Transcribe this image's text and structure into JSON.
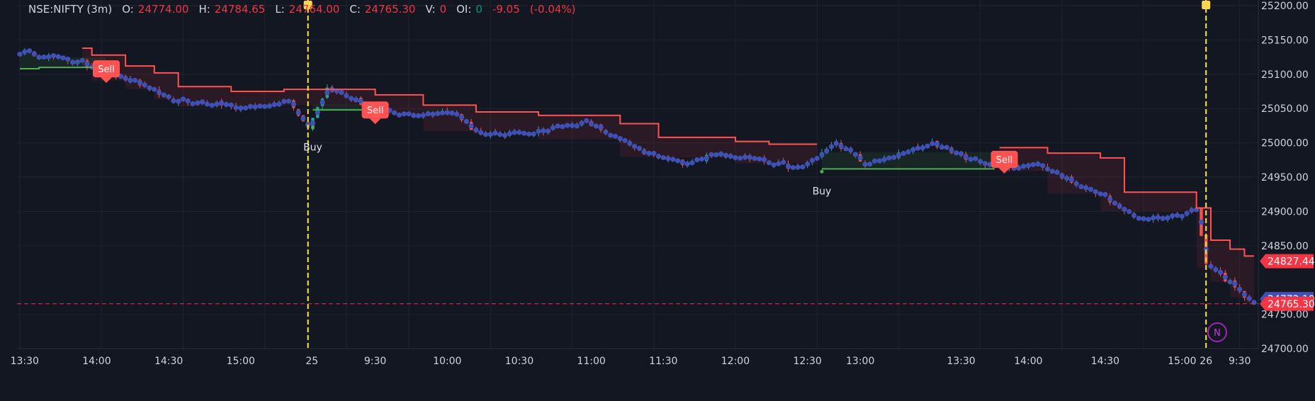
{
  "legend": {
    "symbol": "NSE:NIFTY (3m)",
    "o_label": "O:",
    "o_value": "24774.00",
    "h_label": "H:",
    "h_value": "24784.65",
    "l_label": "L:",
    "l_value": "24764.00",
    "c_label": "C:",
    "c_value": "24765.30",
    "v_label": "V:",
    "v_value": "0",
    "oi_label": "OI:",
    "oi_value": "0",
    "change": "-9.05",
    "change_pct": "(-0.04%)"
  },
  "colors": {
    "background": "#131722",
    "grid": "#1f2430",
    "candle_up": "#26a69a",
    "candle_down": "#ef5350",
    "dot": "#3f51b5",
    "resistance": "#ff5252",
    "support": "#4caf50",
    "session_marker": "#ffeb3b",
    "last_price": "#f23645",
    "ma_label": "#3f51b5"
  },
  "chart_data": {
    "type": "candlestick",
    "ylim": [
      24700,
      25200
    ],
    "y_ticks": [
      "25200.00",
      "25150.00",
      "25100.00",
      "25050.00",
      "25000.00",
      "24950.00",
      "24900.00",
      "24850.00",
      "24750.00",
      "24700.00"
    ],
    "y_tick_values": [
      25200,
      25150,
      25100,
      25050,
      25000,
      24950,
      24900,
      24850,
      24750,
      24700
    ],
    "x_ticks": [
      "13:30",
      "14:00",
      "14:30",
      "15:00",
      "25",
      "9:30",
      "10:00",
      "10:30",
      "11:00",
      "11:30",
      "12:00",
      "12:30",
      "13:00",
      "13:30",
      "14:00",
      "14:30",
      "15:00",
      "26",
      "9:30"
    ],
    "price_labels": [
      {
        "value": 24827.44,
        "text": "24827.44",
        "kind": "resistance"
      },
      {
        "value": 24772.19,
        "text": "24772.19",
        "kind": "ma"
      },
      {
        "value": 24765.3,
        "text": "24765.30",
        "kind": "last"
      }
    ],
    "signals": [
      {
        "type": "sell",
        "label": "Sell"
      },
      {
        "type": "buy",
        "label": "Buy"
      },
      {
        "type": "sell",
        "label": "Sell"
      },
      {
        "type": "buy",
        "label": "Buy"
      },
      {
        "type": "sell",
        "label": "Sell"
      }
    ],
    "session_breaks": [
      "25",
      "26"
    ],
    "watermark": "N",
    "path_segments": [
      {
        "from": 0,
        "to": 12,
        "v0": 25133,
        "v1": 25118
      },
      {
        "from": 12,
        "to": 27,
        "v0": 25118,
        "v1": 25080
      },
      {
        "from": 27,
        "to": 31,
        "v0": 25080,
        "v1": 25062
      },
      {
        "from": 31,
        "to": 43,
        "v0": 25062,
        "v1": 25055
      },
      {
        "from": 43,
        "to": 45,
        "v0": 25055,
        "v1": 25050
      },
      {
        "from": 45,
        "to": 56,
        "v0": 25050,
        "v1": 25060
      },
      {
        "from": 56,
        "to": 60,
        "v0": 25060,
        "v1": 25025
      },
      {
        "from": 60,
        "to": 64,
        "v0": 25025,
        "v1": 25080
      },
      {
        "from": 64,
        "to": 72,
        "v0": 25080,
        "v1": 25055
      },
      {
        "from": 72,
        "to": 80,
        "v0": 25055,
        "v1": 25040
      },
      {
        "from": 80,
        "to": 90,
        "v0": 25040,
        "v1": 25045
      },
      {
        "from": 90,
        "to": 96,
        "v0": 25045,
        "v1": 25010
      },
      {
        "from": 96,
        "to": 106,
        "v0": 25010,
        "v1": 25015
      },
      {
        "from": 106,
        "to": 118,
        "v0": 25015,
        "v1": 25030
      },
      {
        "from": 118,
        "to": 130,
        "v0": 25030,
        "v1": 24985
      },
      {
        "from": 130,
        "to": 138,
        "v0": 24985,
        "v1": 24970
      },
      {
        "from": 138,
        "to": 146,
        "v0": 24970,
        "v1": 24985
      },
      {
        "from": 146,
        "to": 154,
        "v0": 24985,
        "v1": 24975
      },
      {
        "from": 154,
        "to": 162,
        "v0": 24975,
        "v1": 24962
      },
      {
        "from": 162,
        "to": 170,
        "v0": 24962,
        "v1": 25000
      },
      {
        "from": 170,
        "to": 176,
        "v0": 25000,
        "v1": 24968
      },
      {
        "from": 176,
        "to": 184,
        "v0": 24968,
        "v1": 24985
      },
      {
        "from": 184,
        "to": 190,
        "v0": 24985,
        "v1": 25000
      },
      {
        "from": 190,
        "to": 198,
        "v0": 25000,
        "v1": 24975
      },
      {
        "from": 198,
        "to": 206,
        "v0": 24975,
        "v1": 24965
      },
      {
        "from": 206,
        "to": 212,
        "v0": 24965,
        "v1": 24968
      },
      {
        "from": 212,
        "to": 226,
        "v0": 24968,
        "v1": 24920
      },
      {
        "from": 226,
        "to": 232,
        "v0": 24920,
        "v1": 24890
      },
      {
        "from": 232,
        "to": 242,
        "v0": 24890,
        "v1": 24895
      },
      {
        "from": 242,
        "to": 245,
        "v0": 24895,
        "v1": 24905
      },
      {
        "from": 245,
        "to": 247,
        "v0": 24905,
        "v1": 24825
      },
      {
        "from": 247,
        "to": 252,
        "v0": 24825,
        "v1": 24795
      },
      {
        "from": 252,
        "to": 257,
        "v0": 24795,
        "v1": 24765
      }
    ],
    "resistance_steps": [
      {
        "from": 13,
        "to": 15,
        "v": 25138
      },
      {
        "from": 15,
        "to": 22,
        "v": 25128
      },
      {
        "from": 22,
        "to": 28,
        "v": 25112
      },
      {
        "from": 28,
        "to": 33,
        "v": 25102
      },
      {
        "from": 33,
        "to": 44,
        "v": 25082
      },
      {
        "from": 44,
        "to": 55,
        "v": 25075
      },
      {
        "from": 55,
        "to": 74,
        "v": 25078
      },
      {
        "from": 74,
        "to": 84,
        "v": 25070
      },
      {
        "from": 84,
        "to": 95,
        "v": 25055
      },
      {
        "from": 95,
        "to": 108,
        "v": 25045
      },
      {
        "from": 108,
        "to": 125,
        "v": 25040
      },
      {
        "from": 125,
        "to": 133,
        "v": 25028
      },
      {
        "from": 133,
        "to": 149,
        "v": 25008
      },
      {
        "from": 149,
        "to": 156,
        "v": 25002
      },
      {
        "from": 156,
        "to": 166,
        "v": 24998
      },
      {
        "from": 204,
        "to": 214,
        "v": 24993
      },
      {
        "from": 214,
        "to": 225,
        "v": 24985
      },
      {
        "from": 225,
        "to": 230,
        "v": 24978
      },
      {
        "from": 230,
        "to": 245,
        "v": 24928
      },
      {
        "from": 245,
        "to": 248,
        "v": 24905
      },
      {
        "from": 248,
        "to": 252,
        "v": 24858
      },
      {
        "from": 252,
        "to": 255,
        "v": 24845
      },
      {
        "from": 255,
        "to": 257,
        "v": 24835
      }
    ],
    "support_steps": [
      {
        "from": 0,
        "to": 4,
        "v": 25108
      },
      {
        "from": 4,
        "to": 18,
        "v": 25110
      },
      {
        "from": 61,
        "to": 73,
        "v": 25048
      },
      {
        "from": 167,
        "to": 203,
        "v": 24962
      }
    ],
    "signal_positions": [
      {
        "i": 18,
        "v": 25110,
        "type": "sell"
      },
      {
        "i": 61,
        "v": 25022,
        "type": "buy"
      },
      {
        "i": 74,
        "v": 25050,
        "type": "sell"
      },
      {
        "i": 167,
        "v": 24958,
        "type": "buy"
      },
      {
        "i": 205,
        "v": 24978,
        "type": "sell"
      }
    ],
    "session_break_indices": [
      60,
      247
    ],
    "x_tick_indices": [
      0,
      17,
      34,
      51,
      60,
      68,
      81,
      98,
      115,
      132,
      149,
      166,
      183,
      200,
      217,
      234,
      251,
      247,
      254
    ]
  }
}
